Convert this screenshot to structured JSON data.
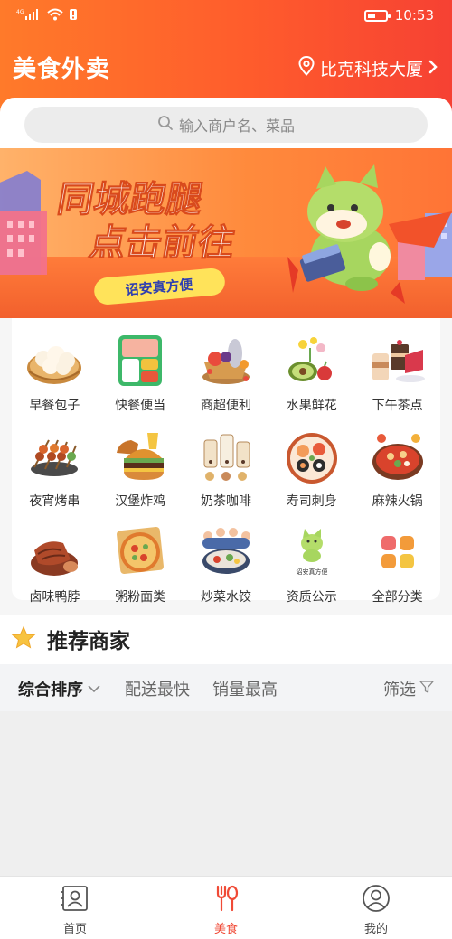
{
  "status_bar": {
    "time": "10:53",
    "network": "4G"
  },
  "header": {
    "app_title": "美食外卖",
    "location": "比克科技大厦"
  },
  "search": {
    "placeholder": "输入商户名、菜品"
  },
  "banner": {
    "line1": "同城跑腿",
    "line2": "点击前往",
    "tag": "诏安真方便"
  },
  "categories": [
    {
      "label": "早餐包子",
      "icon": "baozi-icon"
    },
    {
      "label": "快餐便当",
      "icon": "bento-icon"
    },
    {
      "label": "商超便利",
      "icon": "grocery-icon"
    },
    {
      "label": "水果鲜花",
      "icon": "fruit-icon"
    },
    {
      "label": "下午茶点",
      "icon": "dessert-icon"
    },
    {
      "label": "夜宵烤串",
      "icon": "skewer-icon"
    },
    {
      "label": "汉堡炸鸡",
      "icon": "burger-icon"
    },
    {
      "label": "奶茶咖啡",
      "icon": "milktea-icon"
    },
    {
      "label": "寿司刺身",
      "icon": "sushi-icon"
    },
    {
      "label": "麻辣火锅",
      "icon": "hotpot-icon"
    },
    {
      "label": "卤味鸭脖",
      "icon": "duckneck-icon"
    },
    {
      "label": "粥粉面类",
      "icon": "noodle-icon"
    },
    {
      "label": "炒菜水饺",
      "icon": "dumpling-icon"
    },
    {
      "label": "资质公示",
      "icon": "qualification-icon"
    },
    {
      "label": "全部分类",
      "icon": "all-categories-icon"
    }
  ],
  "qualification_logo_text": "诏安真方便",
  "recommend": {
    "title": "推荐商家"
  },
  "sort": {
    "comprehensive": "综合排序",
    "fastest": "配送最快",
    "top_sales": "销量最高",
    "filter": "筛选"
  },
  "tabs": [
    {
      "label": "首页"
    },
    {
      "label": "美食"
    },
    {
      "label": "我的"
    }
  ],
  "colors": {
    "accent": "#f04a36",
    "header_start": "#ff7a2a",
    "header_end": "#f64133"
  }
}
